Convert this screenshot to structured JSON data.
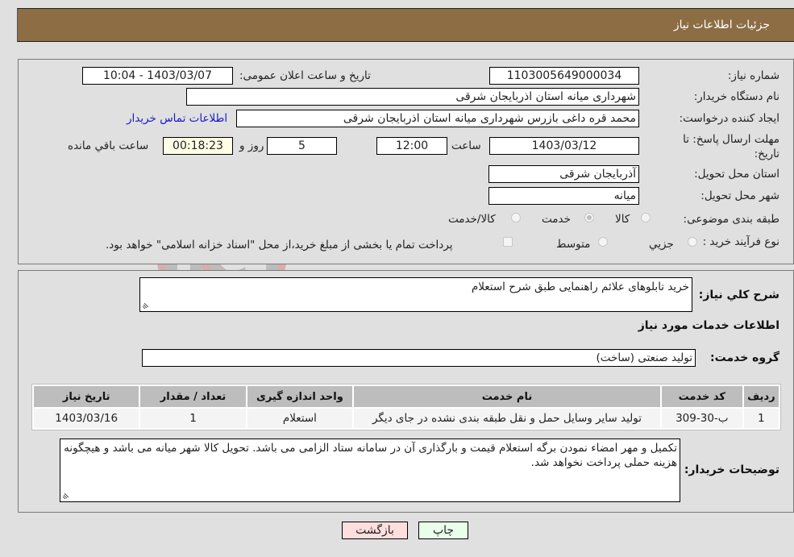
{
  "header": {
    "title": "جزئیات اطلاعات نیاز"
  },
  "fields": {
    "need_number": {
      "label": "شماره نیاز:",
      "value": "1103005649000034"
    },
    "announce_datetime": {
      "label": "تاریخ و ساعت اعلان عمومی:",
      "value": "1403/03/07 - 10:04"
    },
    "buyer_org": {
      "label": "نام دستگاه خریدار:",
      "value": "شهرداری میانه استان اذربایجان شرقی"
    },
    "requester": {
      "label": "ایجاد کننده درخواست:",
      "value": "محمد قره داغی بازرس شهرداری میانه استان اذربایجان شرقی"
    },
    "buyer_contact_link": "اطلاعات تماس خریدار",
    "deadline": {
      "label": "مهلت ارسال پاسخ: تا تاریخ:",
      "date": "1403/03/12",
      "time_label": "ساعت",
      "time": "12:00",
      "days": "5",
      "days_label": "روز و",
      "remaining": "00:18:23",
      "remaining_label": "ساعت باقي مانده"
    },
    "delivery_province": {
      "label": "استان محل تحویل:",
      "value": "آذربایجان شرقی"
    },
    "delivery_city": {
      "label": "شهر محل تحویل:",
      "value": "میانه"
    },
    "category": {
      "label": "طبقه بندی موضوعی:",
      "options": [
        "کالا",
        "خدمت",
        "کالا/خدمت"
      ],
      "selected": "خدمت"
    },
    "purchase_type": {
      "label": "نوع فرآیند خرید :",
      "options": [
        "جزيي",
        "متوسط"
      ],
      "selected": "",
      "treasury_note": "پرداخت تمام یا بخشی از مبلغ خرید،از محل \"اسناد خزانه اسلامی\" خواهد بود.",
      "treasury_checked": false
    }
  },
  "summary": {
    "label": "شرح كلي نياز:",
    "value": "خرید تابلوهای علائم راهنمایی طبق شرح استعلام",
    "services_heading": "اطلاعات خدمات مورد نیاز",
    "service_group_label": "گروه خدمت:",
    "service_group_value": "تولید صنعتی (ساخت)"
  },
  "table": {
    "headers": [
      "ردیف",
      "کد خدمت",
      "نام خدمت",
      "واحد اندازه گیری",
      "تعداد / مقدار",
      "تاریخ نیاز"
    ],
    "rows": [
      [
        "1",
        "ب-30-309",
        "تولید سایر وسایل حمل و نقل طبقه بندی نشده در جای دیگر",
        "استعلام",
        "1",
        "1403/03/16"
      ]
    ]
  },
  "buyer_notes": {
    "label": "توضیحات خریدار:",
    "value": "تکمیل و مهر امضاء نمودن برگه استعلام قیمت و بارگذاری آن در سامانه ستاد الزامی می باشد. تحویل کالا شهر میانه می باشد و هیچگونه هزینه حملی پرداخت نخواهد شد."
  },
  "buttons": {
    "print": "چاپ",
    "back": "بازگشت"
  },
  "colors": {
    "header_bg": "#8c6d44",
    "print_bg": "#eaffea",
    "back_bg": "#ffdede",
    "link": "#1a1acc"
  }
}
